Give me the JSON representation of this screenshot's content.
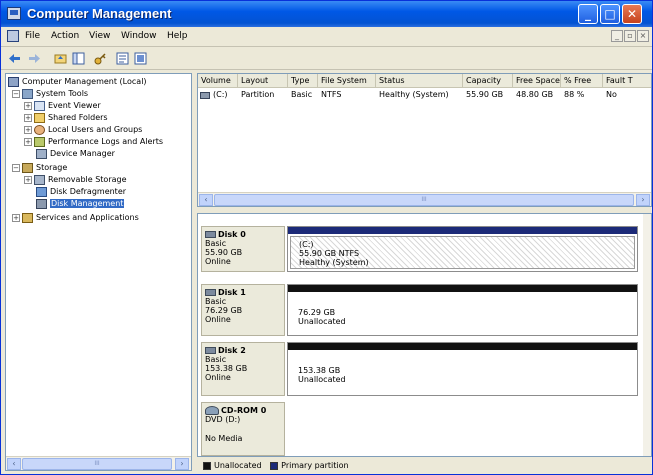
{
  "window": {
    "title": "Computer Management"
  },
  "menu": {
    "file": "File",
    "action": "Action",
    "view": "View",
    "window": "Window",
    "help": "Help",
    "mdi_min": "_",
    "mdi_max": "▫",
    "mdi_close": "×"
  },
  "tree": {
    "root": "Computer Management (Local)",
    "system_tools": "System Tools",
    "event_viewer": "Event Viewer",
    "shared_folders": "Shared Folders",
    "local_users": "Local Users and Groups",
    "perf_logs": "Performance Logs and Alerts",
    "device_manager": "Device Manager",
    "storage": "Storage",
    "removable_storage": "Removable Storage",
    "disk_defrag": "Disk Defragmenter",
    "disk_management": "Disk Management",
    "services_apps": "Services and Applications"
  },
  "volume_table": {
    "headers": [
      "Volume",
      "Layout",
      "Type",
      "File System",
      "Status",
      "Capacity",
      "Free Space",
      "% Free",
      "Fault T"
    ],
    "rows": [
      [
        "(C:)",
        "Partition",
        "Basic",
        "NTFS",
        "Healthy (System)",
        "55.90 GB",
        "48.80 GB",
        "88 %",
        "No"
      ]
    ]
  },
  "disks": [
    {
      "name": "Disk 0",
      "type": "Basic",
      "size": "55.90 GB",
      "status": "Online",
      "partition": {
        "line1": "(C:)",
        "line2": "55.90 GB NTFS",
        "line3": "Healthy (System)"
      }
    },
    {
      "name": "Disk 1",
      "type": "Basic",
      "size": "76.29 GB",
      "status": "Online",
      "partition": {
        "line1": "76.29 GB",
        "line2": "Unallocated"
      }
    },
    {
      "name": "Disk 2",
      "type": "Basic",
      "size": "153.38 GB",
      "status": "Online",
      "partition": {
        "line1": "153.38 GB",
        "line2": "Unallocated"
      }
    },
    {
      "name": "CD-ROM 0",
      "type": "DVD (D:)",
      "status": "No Media"
    }
  ],
  "legend": {
    "unallocated": "Unallocated",
    "primary": "Primary partition"
  },
  "colors": {
    "primary": "#1c2a78",
    "unallocated": "#111111",
    "selection": "#316ac5",
    "titlebar": "#0058e6"
  },
  "scroll": {
    "grip": "III"
  }
}
